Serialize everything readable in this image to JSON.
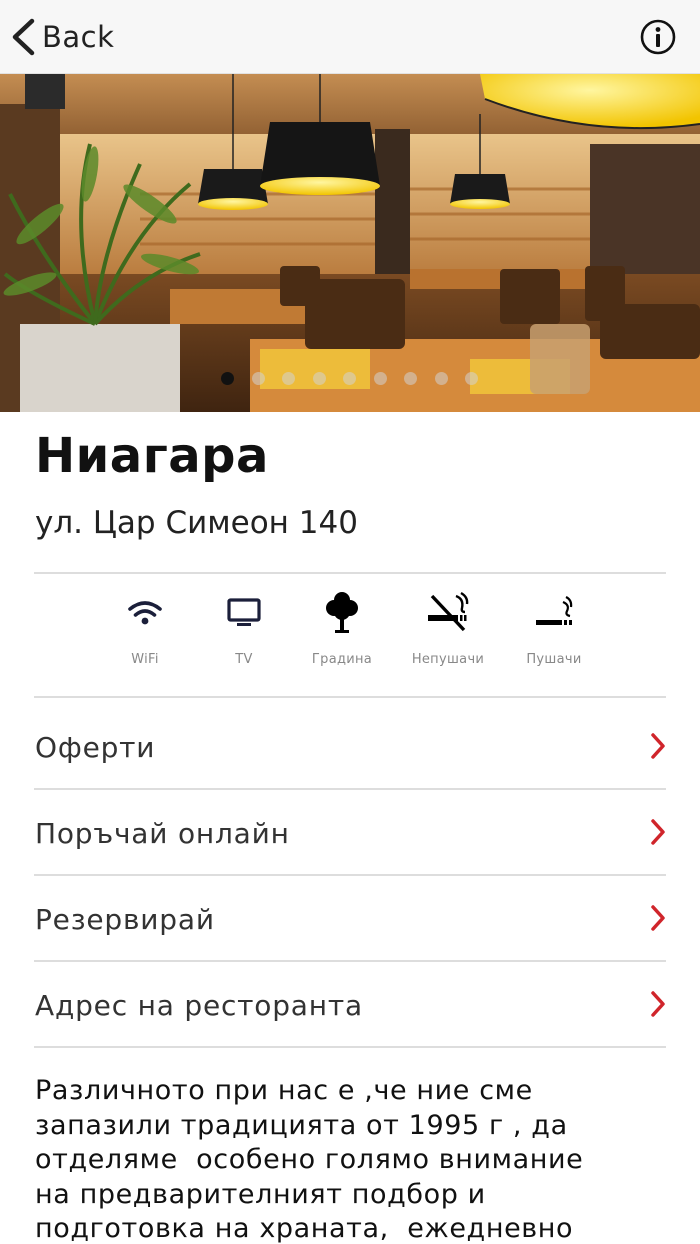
{
  "navbar": {
    "back_label": "Back",
    "back_icon": "chevron-left-icon",
    "info_icon": "info-circle-icon"
  },
  "gallery": {
    "image_description": "restaurant interior photo",
    "slide_count": 9,
    "active_slide": 1
  },
  "restaurant": {
    "name": "Ниагара",
    "address": "ул. Цар Симеон 140"
  },
  "amenities": [
    {
      "icon": "wifi-icon",
      "label": "WiFi"
    },
    {
      "icon": "tv-icon",
      "label": "TV"
    },
    {
      "icon": "tree-icon",
      "label": "Градина"
    },
    {
      "icon": "no-smoking-icon",
      "label": "Непушачи"
    },
    {
      "icon": "smoking-icon",
      "label": "Пушачи"
    }
  ],
  "menu": [
    {
      "label": "Оферти"
    },
    {
      "label": "Поръчай онлайн"
    },
    {
      "label": "Резервирай"
    },
    {
      "label": "Адрес на ресторанта"
    }
  ],
  "description": "Различното при нас е ,че ние сме\nзапазили традицията от 1995 г , да\nотделяме  особено голямо внимание\nна предварителният подбор и\nподготовка на храната,  ежедневно",
  "colors": {
    "accent": "#d0252b",
    "navbar_bg": "#f7f7f7",
    "divider": "#dddddd"
  }
}
